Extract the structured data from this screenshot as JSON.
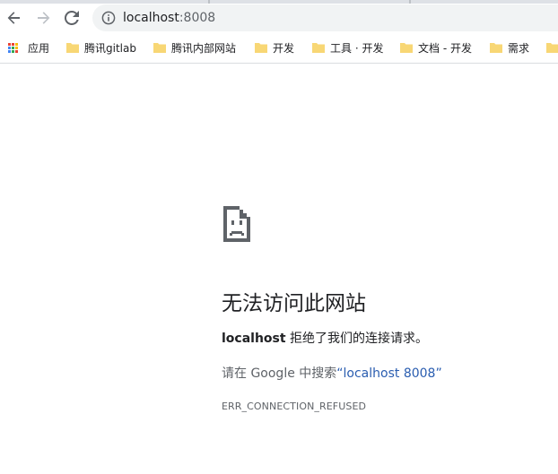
{
  "browser": {
    "url_host": "localhost",
    "url_port": ":8008",
    "icons": {
      "back": "arrow-left-icon",
      "forward": "arrow-right-icon",
      "reload": "reload-icon",
      "info": "info-circle-icon"
    }
  },
  "bookmarks": {
    "apps_label": "应用",
    "items": [
      {
        "label": "腾讯gitlab",
        "icon": "folder-icon"
      },
      {
        "label": "腾讯内部网站",
        "icon": "folder-icon"
      },
      {
        "label": "开发",
        "icon": "folder-icon"
      },
      {
        "label": "工具 · 开发",
        "icon": "folder-icon"
      },
      {
        "label": "文档 - 开发",
        "icon": "folder-icon"
      },
      {
        "label": "需求",
        "icon": "folder-icon"
      },
      {
        "label": "",
        "icon": "folder-icon"
      }
    ]
  },
  "error_page": {
    "icon": "sad-page-icon",
    "title": "无法访问此网站",
    "host_bold": "localhost",
    "detail_text": " 拒绝了我们的连接请求。",
    "search_prefix": "请在 Google 中搜索",
    "search_link": "“localhost 8008”",
    "error_code": "ERR_CONNECTION_REFUSED"
  },
  "colors": {
    "folder": "#f8d775",
    "link": "#2a5db0",
    "omnibox_bg": "#f1f3f4"
  }
}
